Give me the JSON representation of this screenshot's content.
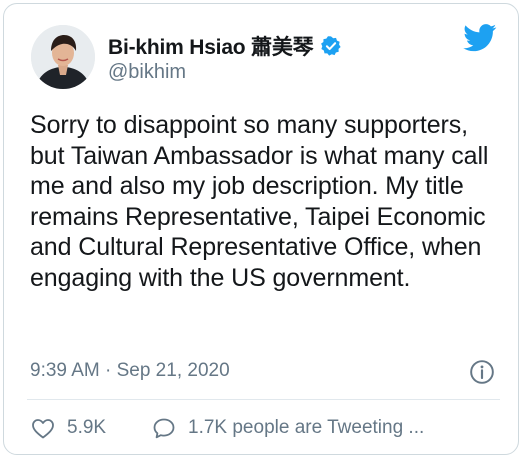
{
  "tweet": {
    "author": {
      "display_name": "Bi-khim Hsiao 蕭美琴",
      "handle": "@bikhim",
      "verified": true,
      "avatar_icon": "person-portrait"
    },
    "brand_icon": "twitter-bird-icon",
    "body": "Sorry to disappoint so many supporters, but Taiwan Ambassador is what many call me and also my job description. My title remains Representative, Taipei Economic and Cultural Representative Office, when engaging with the US government.",
    "timestamp": "9:39 AM · Sep 21, 2020",
    "likes": "5.9K",
    "conversation": "1.7K people are Tweeting ...",
    "colors": {
      "brand_blue": "#1da1f2",
      "text": "#14171a",
      "secondary": "#657786"
    }
  }
}
